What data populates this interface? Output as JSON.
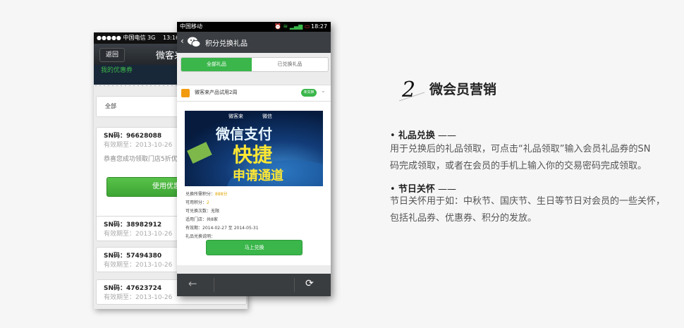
{
  "back_phone": {
    "status": {
      "carrier": "●●●●● 中国电信  3G",
      "time": "13:16"
    },
    "nav": {
      "back_label": "返回",
      "title": "微客来"
    },
    "banner_text": "我的优惠券",
    "select_value": "全部",
    "coupons": [
      {
        "sn": "SN码：96628088",
        "expiry": "有效期至：2013-10-26",
        "message": "恭喜您成功领取门店5折优惠券，请到店使用吧~",
        "use_button": "使用优惠券"
      },
      {
        "sn": "SN码：38982912",
        "expiry": "有效期至：2013-10-26"
      },
      {
        "sn": "SN码：57494380",
        "expiry": "有效期至：2013-10-26"
      },
      {
        "sn": "SN码：47623724",
        "expiry": "有效期至：2013-10-26"
      }
    ]
  },
  "front_phone": {
    "status": {
      "carrier": "中国移动",
      "time": "18:27"
    },
    "nav": {
      "title": "积分兑换礼品"
    },
    "tabs": [
      {
        "label": "全部礼品",
        "active": true
      },
      {
        "label": "已兑换礼品",
        "active": false
      }
    ],
    "item": {
      "title": "微客来产品试用2周",
      "badge": "未兑换"
    },
    "promo": {
      "top_left": "微客来",
      "top_right": "微信",
      "line1": "微信支付",
      "line2": "快捷",
      "line3": "申请通道"
    },
    "details": [
      {
        "label": "兑换所需积分：",
        "value": "888分",
        "highlight": true
      },
      {
        "label": "可用积分：",
        "value": "2",
        "highlight": true
      },
      {
        "label": "可兑换次数：",
        "value": "无限",
        "highlight": false
      },
      {
        "label": "适用门店：",
        "value": "共8家",
        "highlight": false
      },
      {
        "label": "有效期：",
        "value": "2014-02-27 至 2014-05-31",
        "highlight": false
      },
      {
        "label": "礼品兑换说明：",
        "value": "",
        "highlight": false
      }
    ],
    "redeem_button": "马上兑换"
  },
  "section": {
    "number": "2",
    "title": "微会员营销",
    "items": [
      {
        "head": "礼品兑换",
        "lines": [
          "用于兑换后的礼品领取，可点击“礼品领取”输入会员礼品券的SN",
          "码完成领取，或者在会员的手机上输入你的交易密码完成领取。"
        ]
      },
      {
        "head": "节日关怀",
        "lines": [
          "节日关怀用于如：中秋节、国庆节、生日等节日对会员的一些关怀，",
          "包括礼品券、优惠券、积分的发放。"
        ]
      }
    ]
  },
  "colors": {
    "accent_green": "#3ab64a",
    "highlight_orange": "#e0a400",
    "dark_bar": "#3b3f43"
  }
}
